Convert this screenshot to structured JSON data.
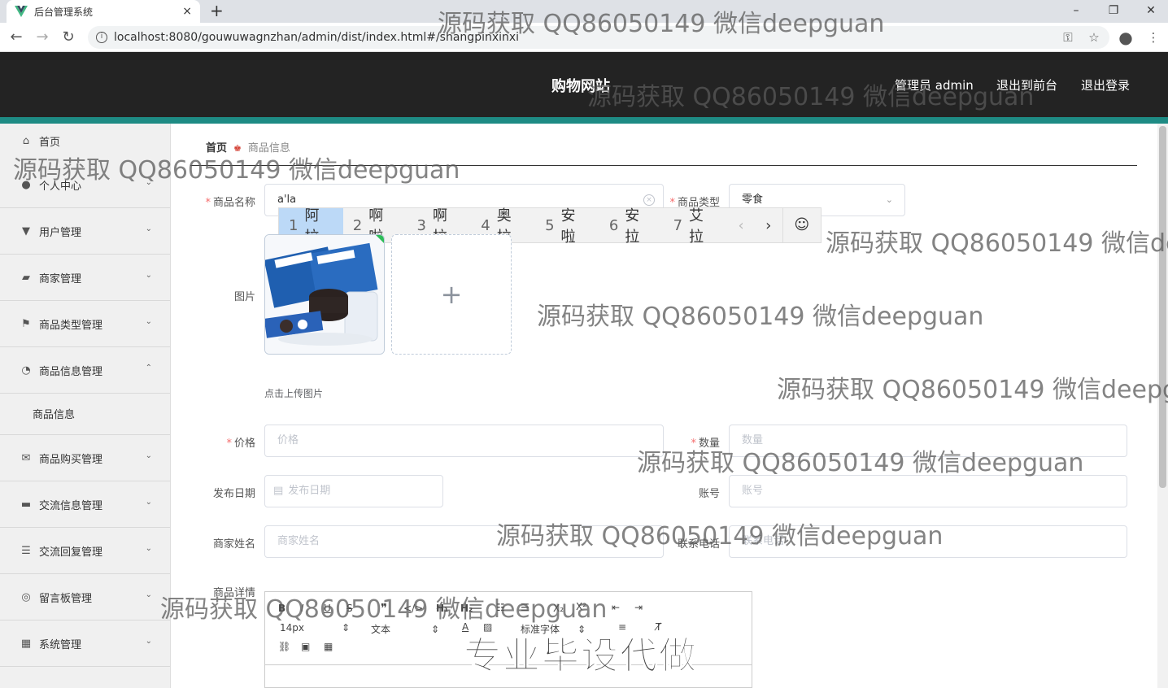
{
  "browser": {
    "tab_title": "后台管理系统",
    "tab_close": "×",
    "new_tab": "+",
    "url": "localhost:8080/gouwuwagnzhan/admin/dist/index.html#/shangpinxinxi",
    "window_controls": [
      "–",
      "❐",
      "✕"
    ]
  },
  "header": {
    "site_title": "购物网站",
    "admin_label": "管理员 admin",
    "to_front": "退出到前台",
    "logout": "退出登录"
  },
  "sidebar": {
    "items": [
      {
        "label": "首页",
        "icon": "home-icon",
        "chev": ""
      },
      {
        "label": "个人中心",
        "icon": "user-icon",
        "chev": "⌄"
      },
      {
        "label": "用户管理",
        "icon": "pin-icon",
        "chev": "⌄"
      },
      {
        "label": "商家管理",
        "icon": "wallet-icon",
        "chev": "⌄"
      },
      {
        "label": "商品类型管理",
        "icon": "flag-icon",
        "chev": "⌄"
      },
      {
        "label": "商品信息管理",
        "icon": "gauge-icon",
        "chev": "⌃"
      },
      {
        "label": "商品购买管理",
        "icon": "mail-icon",
        "chev": "⌄"
      },
      {
        "label": "交流信息管理",
        "icon": "monitor-icon",
        "chev": "⌄"
      },
      {
        "label": "交流回复管理",
        "icon": "sliders-icon",
        "chev": "⌄"
      },
      {
        "label": "留言板管理",
        "icon": "target-icon",
        "chev": "⌄"
      },
      {
        "label": "系统管理",
        "icon": "grid-icon",
        "chev": "⌄"
      }
    ],
    "sub_item": "商品信息"
  },
  "breadcrumb": {
    "home": "首页",
    "current": "商品信息"
  },
  "form": {
    "name_label": "商品名称",
    "name_value": "a'la",
    "type_label": "商品类型",
    "type_value": "零食",
    "image_label": "图片",
    "upload_tip": "点击上传图片",
    "price_label": "价格",
    "price_placeholder": "价格",
    "qty_label": "数量",
    "qty_placeholder": "数量",
    "date_label": "发布日期",
    "date_placeholder": "发布日期",
    "account_label": "账号",
    "account_placeholder": "账号",
    "merchant_label": "商家姓名",
    "merchant_placeholder": "商家姓名",
    "phone_label": "联系电话",
    "phone_placeholder": "联系电话",
    "detail_label": "商品详情"
  },
  "ime": {
    "candidates": [
      {
        "n": "1",
        "t": "阿拉"
      },
      {
        "n": "2",
        "t": "啊啦"
      },
      {
        "n": "3",
        "t": "啊拉"
      },
      {
        "n": "4",
        "t": "奥拉"
      },
      {
        "n": "5",
        "t": "安啦"
      },
      {
        "n": "6",
        "t": "安拉"
      },
      {
        "n": "7",
        "t": "艾拉"
      }
    ]
  },
  "editor": {
    "font_size": "14px",
    "block": "文本",
    "font": "标准字体"
  },
  "watermark": {
    "text": "源码获取 QQ86050149 微信deepguan",
    "text_cut1": "源码获取 QQ86050149 微信de",
    "text_cut2": "源码获取 QQ86050149 微信deepg",
    "promo": "专业毕设代做"
  },
  "colors": {
    "header_bg": "#232323",
    "accent": "#1e8b84",
    "required": "#f56c6c"
  }
}
